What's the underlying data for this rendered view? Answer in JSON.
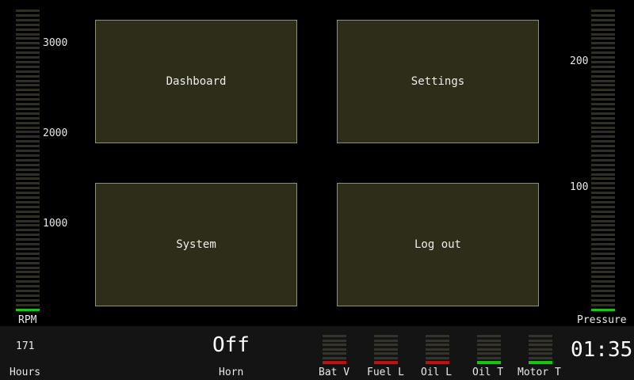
{
  "rpm_gauge": {
    "label": "RPM",
    "ticks": [
      "3000",
      "2000",
      "1000"
    ],
    "level": 0,
    "active_color": "#18c418"
  },
  "pressure_gauge": {
    "label": "Pressure",
    "ticks": [
      "200",
      "100"
    ],
    "level": 0,
    "active_color": "#18c418"
  },
  "menu": {
    "dashboard": "Dashboard",
    "settings": "Settings",
    "system": "System",
    "logout": "Log out"
  },
  "status_bar": {
    "hours_value": "171",
    "hours_label": "Hours",
    "horn_value": "Off",
    "horn_label": "Horn",
    "clock": "01:35",
    "indicators": [
      {
        "label": "Bat V",
        "status_color": "#b81414"
      },
      {
        "label": "Fuel L",
        "status_color": "#b81414"
      },
      {
        "label": "Oil L",
        "status_color": "#b81414"
      },
      {
        "label": "Oil T",
        "status_color": "#18c418"
      },
      {
        "label": "Motor T",
        "status_color": "#18c418"
      }
    ]
  }
}
